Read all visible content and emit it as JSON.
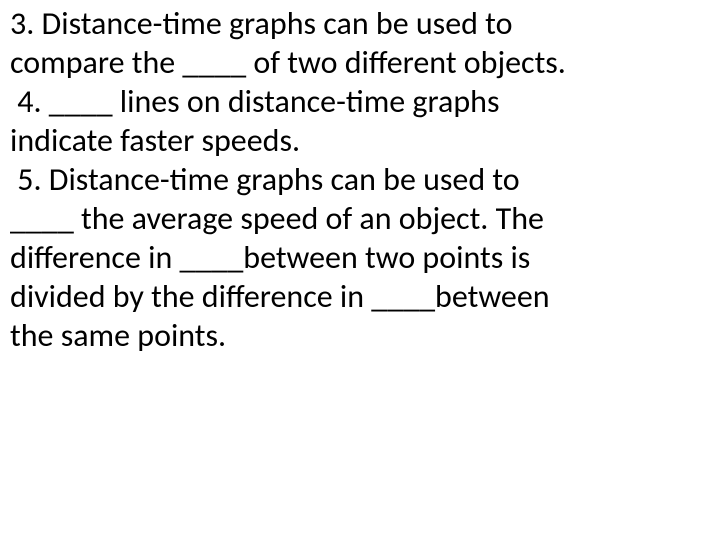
{
  "lines": {
    "l1": "3. Distance-time graphs can be used to",
    "l2": "compare the ____ of two different objects.",
    "l3": " 4. ____ lines on distance-time graphs",
    "l4": "indicate faster speeds.",
    "l5": " 5. Distance-time graphs can be used to",
    "l6": "____ the average speed of an object. The",
    "l7": "difference in ____between two points is",
    "l8": "divided by the difference in ____between",
    "l9": "the same points."
  }
}
